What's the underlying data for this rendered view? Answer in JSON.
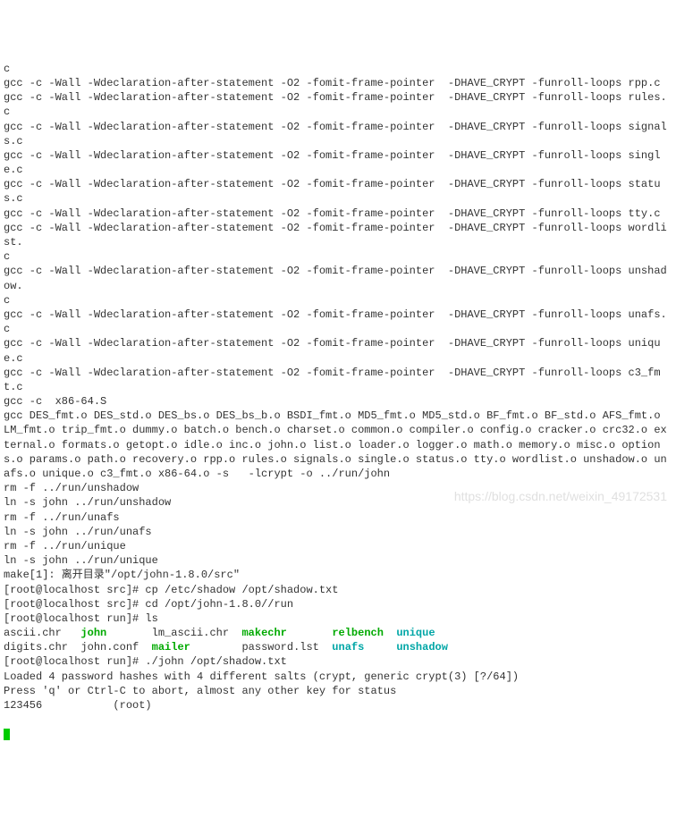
{
  "compile_lines": [
    "c",
    "gcc -c -Wall -Wdeclaration-after-statement -O2 -fomit-frame-pointer  -DHAVE_CRYPT -funroll-loops rpp.c",
    "gcc -c -Wall -Wdeclaration-after-statement -O2 -fomit-frame-pointer  -DHAVE_CRYPT -funroll-loops rules.c",
    "gcc -c -Wall -Wdeclaration-after-statement -O2 -fomit-frame-pointer  -DHAVE_CRYPT -funroll-loops signals.c",
    "gcc -c -Wall -Wdeclaration-after-statement -O2 -fomit-frame-pointer  -DHAVE_CRYPT -funroll-loops single.c",
    "gcc -c -Wall -Wdeclaration-after-statement -O2 -fomit-frame-pointer  -DHAVE_CRYPT -funroll-loops status.c",
    "gcc -c -Wall -Wdeclaration-after-statement -O2 -fomit-frame-pointer  -DHAVE_CRYPT -funroll-loops tty.c",
    "gcc -c -Wall -Wdeclaration-after-statement -O2 -fomit-frame-pointer  -DHAVE_CRYPT -funroll-loops wordlist.",
    "c",
    "gcc -c -Wall -Wdeclaration-after-statement -O2 -fomit-frame-pointer  -DHAVE_CRYPT -funroll-loops unshadow.",
    "c",
    "gcc -c -Wall -Wdeclaration-after-statement -O2 -fomit-frame-pointer  -DHAVE_CRYPT -funroll-loops unafs.c",
    "gcc -c -Wall -Wdeclaration-after-statement -O2 -fomit-frame-pointer  -DHAVE_CRYPT -funroll-loops unique.c",
    "gcc -c -Wall -Wdeclaration-after-statement -O2 -fomit-frame-pointer  -DHAVE_CRYPT -funroll-loops c3_fmt.c",
    "gcc -c  x86-64.S",
    "gcc DES_fmt.o DES_std.o DES_bs.o DES_bs_b.o BSDI_fmt.o MD5_fmt.o MD5_std.o BF_fmt.o BF_std.o AFS_fmt.o LM_fmt.o trip_fmt.o dummy.o batch.o bench.o charset.o common.o compiler.o config.o cracker.o crc32.o external.o formats.o getopt.o idle.o inc.o john.o list.o loader.o logger.o math.o memory.o misc.o options.o params.o path.o recovery.o rpp.o rules.o signals.o single.o status.o tty.o wordlist.o unshadow.o unafs.o unique.o c3_fmt.o x86-64.o -s   -lcrypt -o ../run/john",
    "rm -f ../run/unshadow",
    "ln -s john ../run/unshadow",
    "rm -f ../run/unafs",
    "ln -s john ../run/unafs",
    "rm -f ../run/unique",
    "ln -s john ../run/unique",
    "make[1]: 离开目录\"/opt/john-1.8.0/src\""
  ],
  "prompts": {
    "p1_prefix": "[root@localhost src]# ",
    "p1_cmd": "cp /etc/shadow /opt/shadow.txt",
    "p2_prefix": "[root@localhost src]# ",
    "p2_cmd": "cd /opt/john-1.8.0//run",
    "p3_prefix": "[root@localhost run]# ",
    "p3_cmd": "ls",
    "p4_prefix": "[root@localhost run]# ",
    "p4_cmd": "./john /opt/shadow.txt"
  },
  "ls_line1": {
    "c1": "ascii.chr   ",
    "c2": "john",
    "c2_pad": "       ",
    "c3": "lm_ascii.chr  ",
    "c4": "makechr",
    "c4_pad": "       ",
    "c5": "relbench",
    "c5_pad": "  ",
    "c6": "unique"
  },
  "ls_line2": {
    "c1": "digits.chr  ",
    "c2": "john.conf  ",
    "c3": "mailer",
    "c3_pad": "        ",
    "c4": "password.lst  ",
    "c5": "unafs",
    "c5_pad": "     ",
    "c6": "unshadow"
  },
  "john_output": [
    "Loaded 4 password hashes with 4 different salts (crypt, generic crypt(3) [?/64])",
    "Press 'q' or Ctrl-C to abort, almost any other key for status",
    "123456           (root)"
  ],
  "watermark": "https://blog.csdn.net/weixin_49172531"
}
